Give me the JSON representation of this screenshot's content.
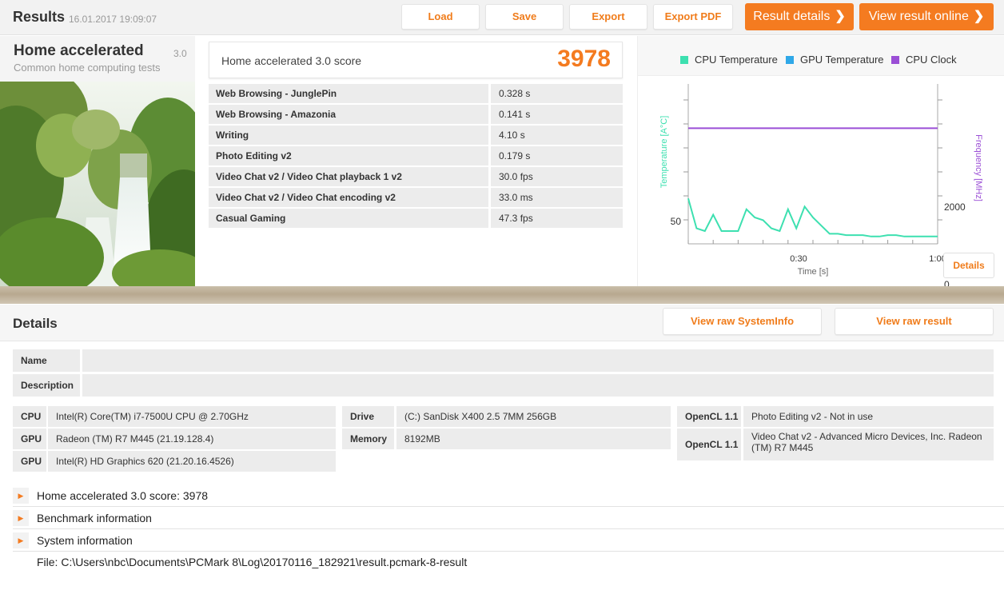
{
  "header": {
    "title": "Results",
    "date": "16.01.2017 19:09:07",
    "buttons": {
      "load": "Load",
      "save": "Save",
      "export": "Export",
      "export_pdf": "Export PDF"
    },
    "result_details": "Result details",
    "view_online": "View result online",
    "chevron": "❯"
  },
  "benchmark": {
    "name": "Home accelerated",
    "version": "3.0",
    "subtitle": "Common home computing tests",
    "image": "waterfall-landscape"
  },
  "score": {
    "label": "Home accelerated 3.0 score",
    "value": "3978"
  },
  "results": [
    {
      "name": "Web Browsing - JunglePin",
      "value": "0.328 s"
    },
    {
      "name": "Web Browsing - Amazonia",
      "value": "0.141 s"
    },
    {
      "name": "Writing",
      "value": "4.10 s"
    },
    {
      "name": "Photo Editing v2",
      "value": "0.179 s"
    },
    {
      "name": "Video Chat v2 / Video Chat playback 1 v2",
      "value": "30.0 fps"
    },
    {
      "name": "Video Chat v2 / Video Chat encoding v2",
      "value": "33.0 ms"
    },
    {
      "name": "Casual Gaming",
      "value": "47.3 fps"
    }
  ],
  "monitor": {
    "legend": [
      "CPU Temperature",
      "GPU Temperature",
      "CPU Clock"
    ],
    "colors": {
      "cpu_temp": "#3de0b0",
      "gpu_temp": "#2fa8e8",
      "cpu_clock": "#9b4fd6",
      "accent": "#f47b20"
    },
    "left_axis_label": "Temperature [A°C]",
    "left_ticks": [
      "50"
    ],
    "right_axis_label": "Frequency [MHz]",
    "right_ticks": [
      "2000",
      "0"
    ],
    "x_ticks": [
      "0:30",
      "1:00"
    ],
    "x_label": "Time [s]",
    "details_button": "Details",
    "series": {
      "time_s": [
        0,
        2,
        4,
        6,
        8,
        10,
        12,
        14,
        16,
        18,
        20,
        22,
        24,
        26,
        28,
        30,
        32,
        34,
        36,
        38,
        40,
        42,
        44,
        46,
        48,
        50,
        52,
        54,
        56,
        58,
        60
      ],
      "cpu_temp_c": [
        57,
        46,
        45,
        51,
        45,
        45,
        45,
        53,
        50,
        49,
        46,
        45,
        53,
        46,
        54,
        50,
        47,
        44,
        44,
        43.5,
        43.5,
        43.5,
        43,
        43,
        43.5,
        43.5,
        43,
        43,
        43,
        43,
        43
      ],
      "cpu_clock_mhz": [
        3930,
        3930,
        3930,
        3930,
        3930,
        3930,
        3930,
        3930,
        3930,
        3930,
        3930,
        3930,
        3930,
        3930,
        3930,
        3930,
        3930,
        3930,
        3930,
        3930,
        3930,
        3930,
        3930,
        3930,
        3930,
        3930,
        3930,
        3930,
        3930,
        3930,
        3930
      ]
    }
  },
  "details": {
    "title": "Details",
    "view_raw_sysinfo": "View raw SystemInfo",
    "view_raw_result": "View raw result",
    "name_label": "Name",
    "description_label": "Description",
    "system": {
      "col1": [
        {
          "label": "CPU",
          "value": "Intel(R) Core(TM) i7-7500U CPU @ 2.70GHz"
        },
        {
          "label": "GPU",
          "value": "Radeon (TM) R7 M445 (21.19.128.4)"
        },
        {
          "label": "GPU",
          "value": "Intel(R) HD Graphics 620 (21.20.16.4526)"
        }
      ],
      "col2": [
        {
          "label": "Drive",
          "value": "(C:) SanDisk X400 2.5 7MM 256GB"
        },
        {
          "label": "Memory",
          "value": "8192MB"
        }
      ],
      "col3": [
        {
          "label": "OpenCL 1.1",
          "value": "Photo Editing v2 - Not in use"
        },
        {
          "label": "OpenCL 1.1",
          "value": "Video Chat v2 - Advanced Micro Devices, Inc. Radeon (TM) R7 M445"
        }
      ]
    },
    "tree": [
      "Home accelerated 3.0 score: 3978",
      "Benchmark information",
      "System information"
    ],
    "tree_arrow": "▶",
    "file": "File: C:\\Users\\nbc\\Documents\\PCMark 8\\Log\\20170116_182921\\result.pcmark-8-result"
  }
}
